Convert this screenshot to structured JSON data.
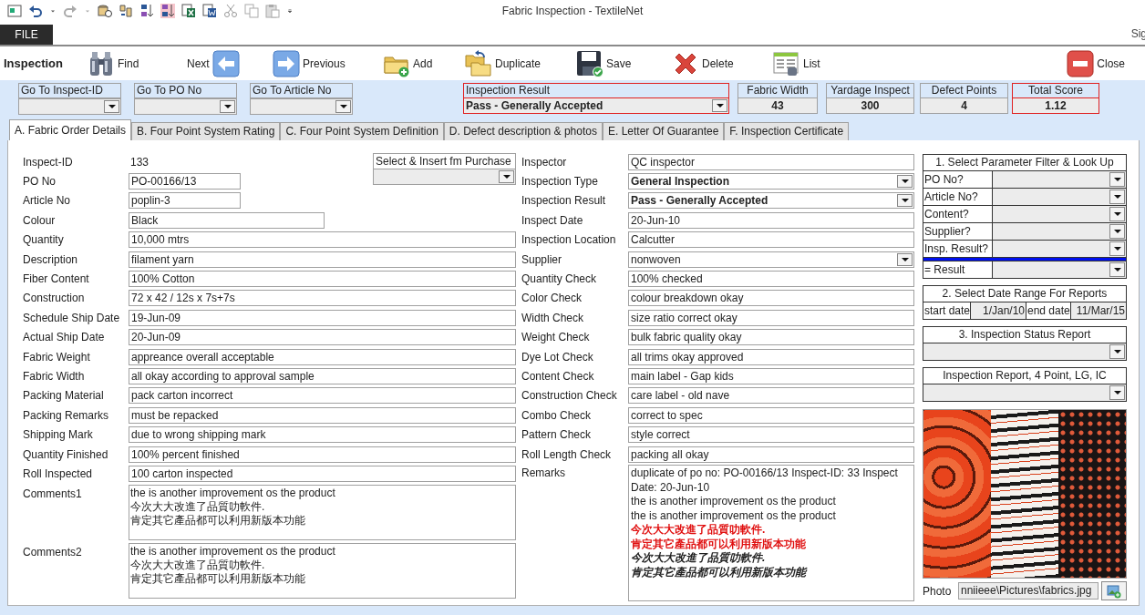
{
  "window": {
    "title": "Fabric Inspection - TextileNet"
  },
  "ribbon": {
    "file_tab": "FILE",
    "account": "Sig"
  },
  "toolbar": {
    "title": "Inspection",
    "buttons": [
      {
        "kind": "find",
        "label": "Find"
      },
      {
        "kind": "next",
        "label": "Next"
      },
      {
        "kind": "previous",
        "label": "Previous"
      },
      {
        "kind": "add",
        "label": "Add"
      },
      {
        "kind": "duplicate",
        "label": "Duplicate"
      },
      {
        "kind": "save",
        "label": "Save"
      },
      {
        "kind": "delete",
        "label": "Delete"
      },
      {
        "kind": "list",
        "label": "List"
      },
      {
        "kind": "close",
        "label": "Close"
      }
    ]
  },
  "navigation": [
    {
      "label": "Go To Inspect-ID"
    },
    {
      "label": "Go To PO No"
    },
    {
      "label": "Go To Article No"
    }
  ],
  "inspection_result": {
    "label": "Inspection Result",
    "value": "Pass - Generally Accepted"
  },
  "stats": [
    {
      "label": "Fabric Width",
      "value": "43",
      "highlighted": false
    },
    {
      "label": "Yardage Inspect",
      "value": "300",
      "highlighted": false
    },
    {
      "label": "Defect Points",
      "value": "4",
      "highlighted": false
    },
    {
      "label": "Total Score",
      "value": "1.12",
      "highlighted": true
    }
  ],
  "tabs": [
    {
      "label": "A. Fabric Order Details",
      "selected": true
    },
    {
      "label": "B. Four Point System Rating",
      "selected": false
    },
    {
      "label": "C. Four Point System Definition",
      "selected": false
    },
    {
      "label": "D. Defect description & photos",
      "selected": false
    },
    {
      "label": "E. Letter Of Guarantee",
      "selected": false
    },
    {
      "label": "F. Inspection Certificate",
      "selected": false
    }
  ],
  "order_details": {
    "inspect_id": {
      "label": "Inspect-ID",
      "value": "133"
    },
    "purchase_select": {
      "label": "Select & Insert fm Purchase"
    },
    "fields": [
      {
        "label": "PO No",
        "value": "PO-00166/13"
      },
      {
        "label": "Article No",
        "value": "poplin-3"
      },
      {
        "label": "Colour",
        "value": "Black"
      },
      {
        "label": "Quantity",
        "value": "10,000 mtrs"
      },
      {
        "label": "Description",
        "value": "filament yarn"
      },
      {
        "label": "Fiber Content",
        "value": "100% Cotton"
      },
      {
        "label": "Construction",
        "value": "72 x 42 / 12s x 7s+7s"
      },
      {
        "label": "Schedule Ship Date",
        "value": "19-Jun-09"
      },
      {
        "label": "Actual Ship Date",
        "value": "20-Jun-09"
      },
      {
        "label": "Fabric Weight",
        "value": "appreance overall acceptable"
      },
      {
        "label": "Fabric Width",
        "value": "all okay according to approval sample"
      },
      {
        "label": "Packing Material",
        "value": "pack carton incorrect"
      },
      {
        "label": "Packing Remarks",
        "value": "must be repacked"
      },
      {
        "label": "Shipping Mark",
        "value": "due to wrong shipping mark"
      },
      {
        "label": "Quantity Finished",
        "value": "100% percent finished"
      },
      {
        "label": "Roll  Inspected",
        "value": "100 carton inspected"
      }
    ],
    "comments": [
      {
        "label": "Comments1",
        "lines": [
          "the is another improvement os the product",
          "今次大大改進了品質叻軟件.",
          "肯定其它產品都可以利用新版本功能"
        ]
      },
      {
        "label": "Comments2",
        "lines": [
          "the is another improvement os the product",
          "今次大大改進了品質叻軟件.",
          "肯定其它產品都可以利用新版本功能"
        ]
      }
    ]
  },
  "inspection_fields": [
    {
      "label": "Inspector",
      "value": "QC inspector",
      "kind": "text",
      "emphasis": false
    },
    {
      "label": "Inspection Type",
      "value": "General Inspection",
      "kind": "dropdown",
      "emphasis": true
    },
    {
      "label": "Inspection Result",
      "value": "Pass - Generally Accepted",
      "kind": "dropdown",
      "emphasis": true
    },
    {
      "label": "Inspect Date",
      "value": "20-Jun-10",
      "kind": "text",
      "emphasis": false
    },
    {
      "label": "Inspection Location",
      "value": "Calcutter",
      "kind": "text",
      "emphasis": false
    },
    {
      "label": "Supplier",
      "value": "nonwoven",
      "kind": "dropdown",
      "emphasis": false
    },
    {
      "label": "Quantity Check",
      "value": "100% checked",
      "kind": "text",
      "emphasis": false
    },
    {
      "label": "Color Check",
      "value": "colour breakdown okay",
      "kind": "text",
      "emphasis": false
    },
    {
      "label": "Width Check",
      "value": "size ratio correct okay",
      "kind": "text",
      "emphasis": false
    },
    {
      "label": "Weight Check",
      "value": "bulk fabric quality okay",
      "kind": "text",
      "emphasis": false
    },
    {
      "label": "Dye Lot Check",
      "value": "all trims okay approved",
      "kind": "text",
      "emphasis": false
    },
    {
      "label": "Content Check",
      "value": "main label - Gap kids",
      "kind": "text",
      "emphasis": false
    },
    {
      "label": "Construction Check",
      "value": "care label - old nave",
      "kind": "text",
      "emphasis": false
    },
    {
      "label": "Combo Check",
      "value": "correct to spec",
      "kind": "text",
      "emphasis": false
    },
    {
      "label": "Pattern Check",
      "value": "style correct",
      "kind": "text",
      "emphasis": false
    },
    {
      "label": "Roll Length Check",
      "value": "packing all okay",
      "kind": "text",
      "emphasis": false
    }
  ],
  "remarks": {
    "label": "Remarks",
    "lines": [
      {
        "text": "duplicate of po no: PO-00166/13 Inspect-ID: 33  Inspect Date: 20-Jun-10",
        "kind": "plain"
      },
      {
        "text": "the is another improvement os the product",
        "kind": "plain"
      },
      {
        "text": "the is another improvement os the product",
        "kind": "plain"
      },
      {
        "text": "今次大大改進了品質叻軟件.",
        "kind": "alert"
      },
      {
        "text": "肯定其它產品都可以利用新版本功能",
        "kind": "alert"
      },
      {
        "text": "今次大大改進了品質叻軟件.",
        "kind": "emphasis"
      },
      {
        "text": "肯定其它產品都可以利用新版本功能",
        "kind": "emphasis"
      }
    ]
  },
  "lookup": {
    "title": "1. Select Parameter Filter & Look Up",
    "filters": [
      {
        "label": "PO No?"
      },
      {
        "label": "Article No?"
      },
      {
        "label": "Content?"
      },
      {
        "label": "Supplier?"
      },
      {
        "label": "Insp. Result?"
      }
    ],
    "result": {
      "label": "= Result"
    }
  },
  "date_range": {
    "title": "2. Select Date Range For  Reports",
    "start_label": "start date",
    "start": "1/Jan/10",
    "end_label": "end date",
    "end": "11/Mar/15"
  },
  "status_report": {
    "title": "3. Inspection Status Report"
  },
  "report_select": {
    "title": "Inspection Report, 4 Point, LG, IC"
  },
  "photo": {
    "label": "Photo",
    "path": "nniieee\\Pictures\\fabrics.jpg"
  }
}
